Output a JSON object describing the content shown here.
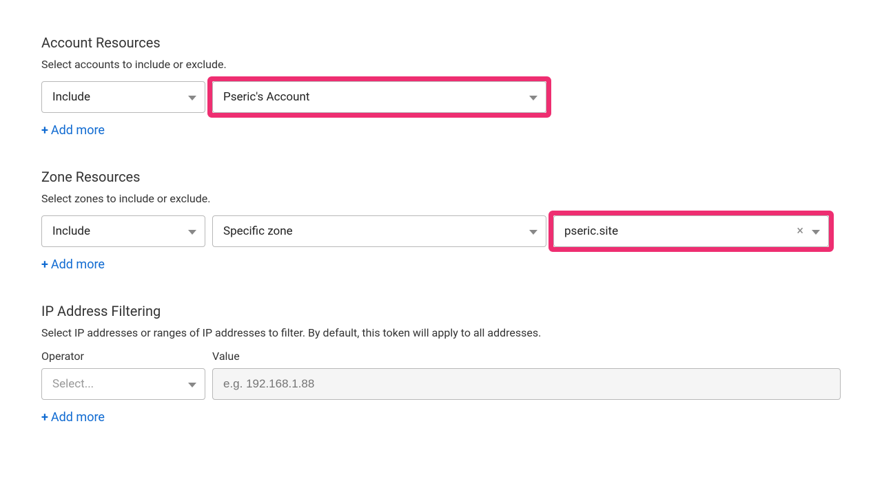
{
  "accountResources": {
    "title": "Account Resources",
    "desc": "Select accounts to include or exclude.",
    "mode": "Include",
    "account": "Pseric's Account",
    "addMore": "Add more"
  },
  "zoneResources": {
    "title": "Zone Resources",
    "desc": "Select zones to include or exclude.",
    "mode": "Include",
    "scope": "Specific zone",
    "zone": "pseric.site",
    "addMore": "Add more"
  },
  "ipFiltering": {
    "title": "IP Address Filtering",
    "desc": "Select IP addresses or ranges of IP addresses to filter. By default, this token will apply to all addresses.",
    "operatorLabel": "Operator",
    "valueLabel": "Value",
    "operatorPlaceholder": "Select...",
    "valuePlaceholder": "e.g. 192.168.1.88",
    "addMore": "Add more"
  }
}
